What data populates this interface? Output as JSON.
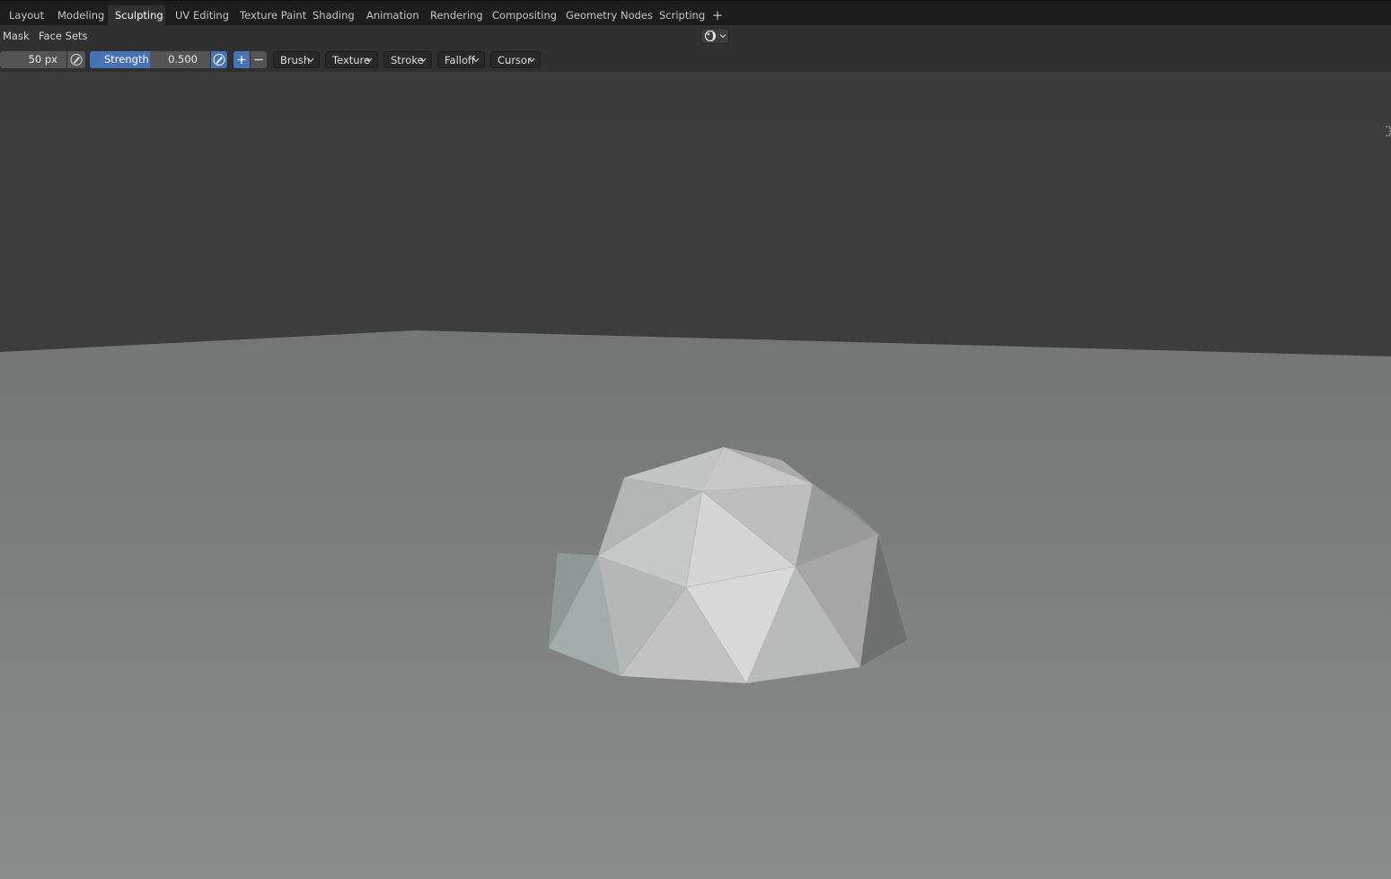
{
  "workspace_tabs": [
    {
      "label": "Layout"
    },
    {
      "label": "Modeling"
    },
    {
      "label": "Sculpting"
    },
    {
      "label": "UV Editing"
    },
    {
      "label": "Texture Paint"
    },
    {
      "label": "Shading"
    },
    {
      "label": "Animation"
    },
    {
      "label": "Rendering"
    },
    {
      "label": "Compositing"
    },
    {
      "label": "Geometry Nodes"
    },
    {
      "label": "Scripting"
    }
  ],
  "active_tab": "Sculpting",
  "add_tab_icon": "plus-icon",
  "header_menus": {
    "mask": "Mask",
    "face_sets": "Face Sets"
  },
  "header_view_widget_icon": "viewport-shading-icon",
  "tool_settings": {
    "radius_value": "50 px",
    "radius_pressure_icon": "pen-pressure-icon",
    "strength_label": "Strength",
    "strength_value": "0.500",
    "strength_fraction": 0.5,
    "strength_pressure_icon": "pen-pressure-icon",
    "direction_add_icon": "plus-icon",
    "direction_subtract_icon": "minus-icon",
    "dropdowns": [
      {
        "label": "Brush"
      },
      {
        "label": "Texture"
      },
      {
        "label": "Stroke"
      },
      {
        "label": "Falloff"
      },
      {
        "label": "Cursor"
      }
    ]
  },
  "colors": {
    "accent": "#4772b3",
    "topbar_bg": "#1d1d1d",
    "header_bg": "#303030",
    "viewport_wall": "#3d3d3d",
    "viewport_floor": "#7c7f7e"
  }
}
